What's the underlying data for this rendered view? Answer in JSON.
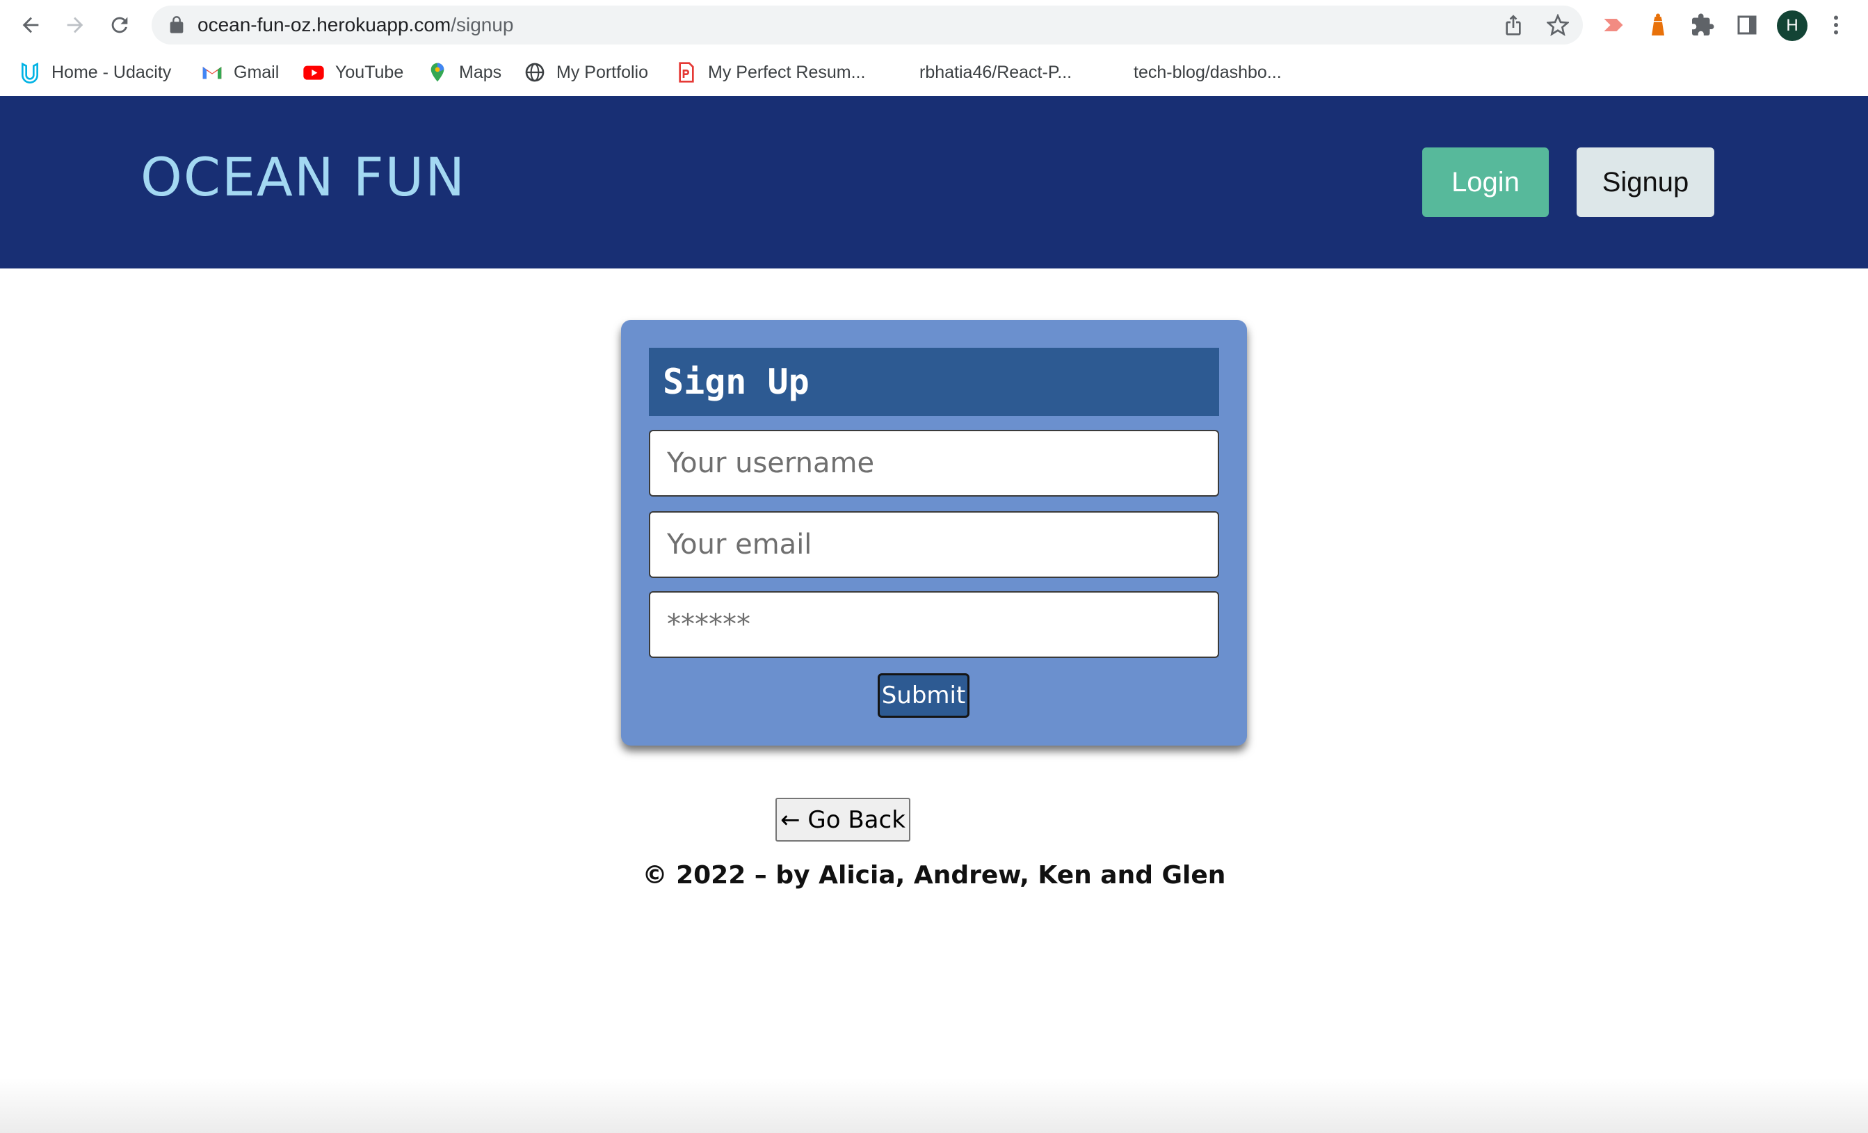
{
  "browser": {
    "url_host": "ocean-fun-oz.herokuapp.com",
    "url_path": "/signup",
    "profile_initial": "H",
    "bookmarks": [
      {
        "label": "Home - Udacity",
        "icon": "udacity-icon"
      },
      {
        "label": "Gmail",
        "icon": "gmail-icon"
      },
      {
        "label": "YouTube",
        "icon": "youtube-icon"
      },
      {
        "label": "Maps",
        "icon": "maps-icon"
      },
      {
        "label": "My Portfolio",
        "icon": "globe-icon"
      },
      {
        "label": "My Perfect Resum...",
        "icon": "resume-icon"
      },
      {
        "label": "rbhatia46/React-P...",
        "icon": ""
      },
      {
        "label": "tech-blog/dashbo...",
        "icon": ""
      }
    ]
  },
  "header": {
    "title": "OCEAN FUN",
    "login_label": "Login",
    "signup_label": "Signup"
  },
  "form": {
    "title": "Sign Up",
    "username_placeholder": "Your username",
    "email_placeholder": "Your email",
    "password_placeholder": "******",
    "submit_label": "Submit"
  },
  "back_label": "← Go Back",
  "footer": "© 2022 – by Alicia, Andrew, Ken and Glen",
  "colors": {
    "header_bg": "#182f74",
    "title": "#a3d8f2",
    "login_bg": "#57b99b",
    "signup_bg": "#dde7e9",
    "card_bg": "#6b90ce",
    "card_header_bg": "#2d5a92"
  }
}
